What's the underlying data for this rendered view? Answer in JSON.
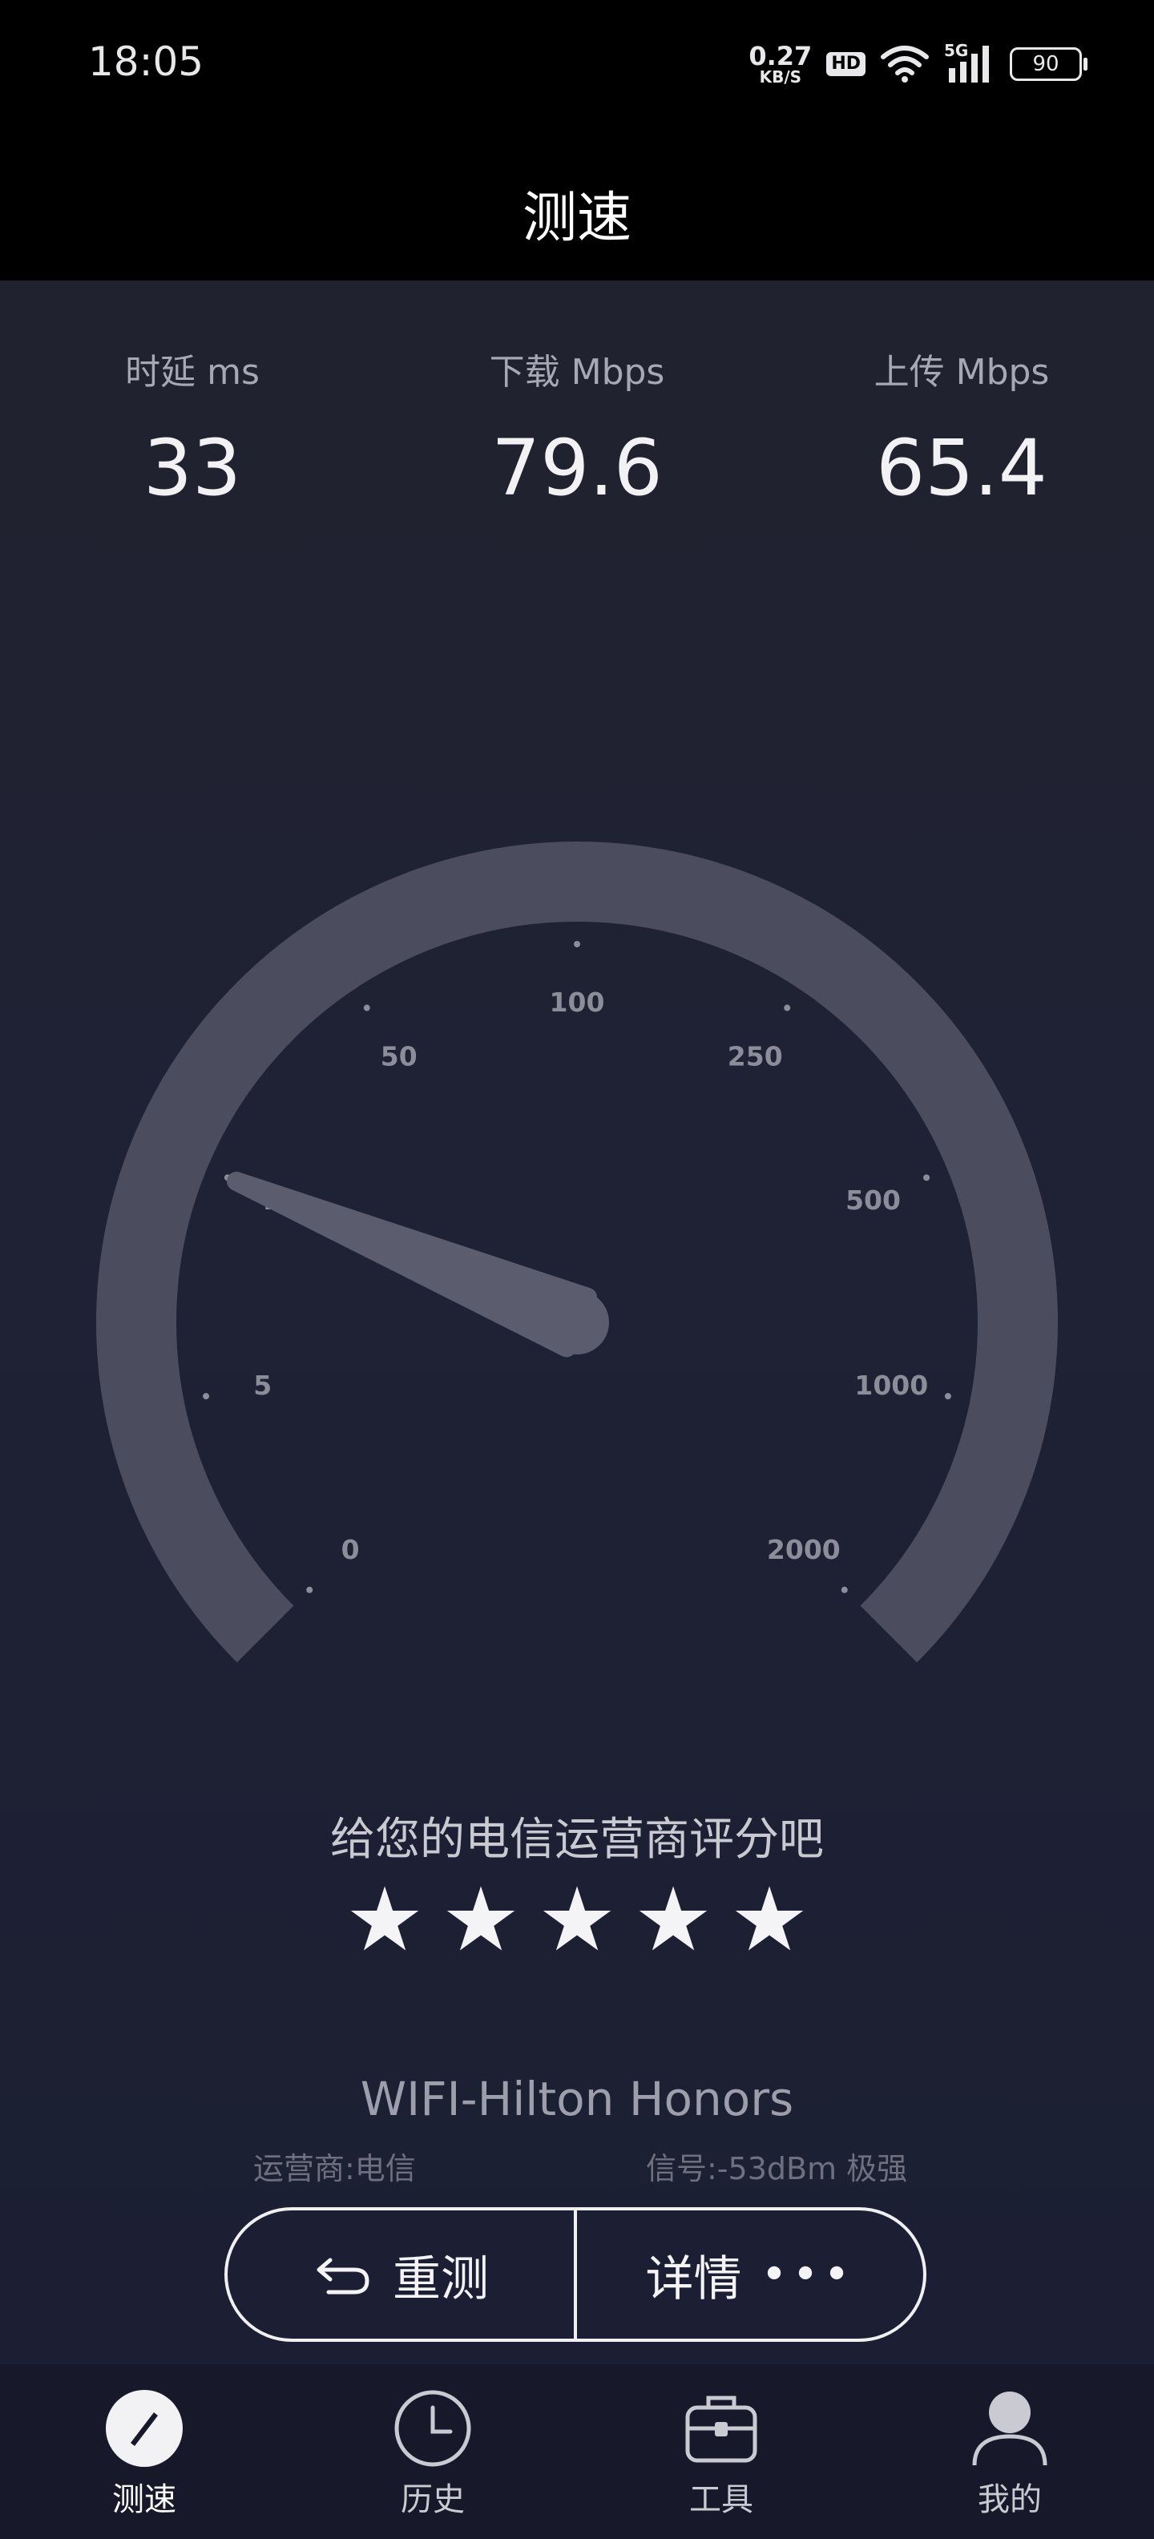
{
  "status_bar": {
    "time": "18:05",
    "net_speed_value": "0.27",
    "net_speed_unit": "KB/S",
    "hd_badge": "HD",
    "network_type": "5G",
    "battery_level": "90"
  },
  "header": {
    "title": "测速"
  },
  "metrics": {
    "latency": {
      "label": "时延 ms",
      "value": "33"
    },
    "download": {
      "label": "下载 Mbps",
      "value": "79.6"
    },
    "upload": {
      "label": "上传 Mbps",
      "value": "65.4"
    }
  },
  "gauge": {
    "scale_labels": [
      "0",
      "5",
      "10",
      "50",
      "100",
      "250",
      "500",
      "1000",
      "2000"
    ],
    "needle_value": 10,
    "colors": {
      "track": "#4b4c5e",
      "needle": "#5b5c6e",
      "tick": "#8c8d9b"
    }
  },
  "rating": {
    "prompt": "给您的电信运营商评分吧",
    "stars_total": 5,
    "star_glyph": "★"
  },
  "network": {
    "name": "WIFI-Hilton Honors",
    "carrier": "运营商:电信",
    "signal": "信号:-53dBm 极强"
  },
  "actions": {
    "retest_label": "重测",
    "details_label": "详情",
    "details_more": "•••"
  },
  "bottom_nav": {
    "items": [
      {
        "label": "测速",
        "icon": "speedometer-icon",
        "active": true
      },
      {
        "label": "历史",
        "icon": "clock-icon",
        "active": false
      },
      {
        "label": "工具",
        "icon": "toolbox-icon",
        "active": false
      },
      {
        "label": "我的",
        "icon": "user-icon",
        "active": false
      }
    ]
  }
}
